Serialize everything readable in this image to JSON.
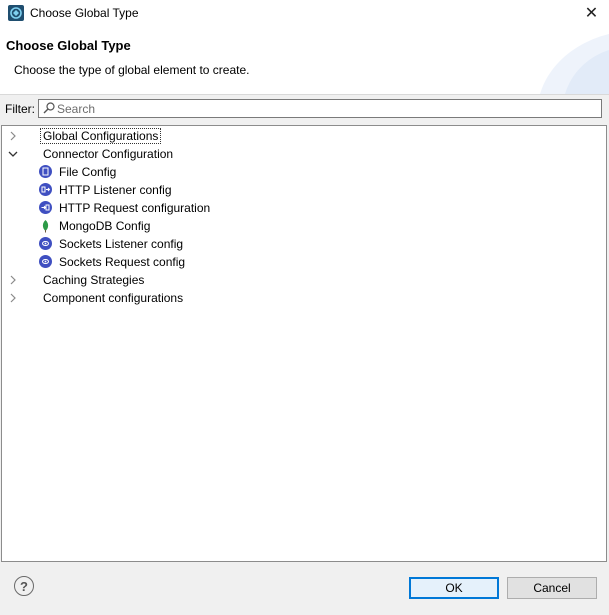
{
  "window": {
    "title": "Choose Global Type",
    "close_glyph": "✕"
  },
  "header": {
    "title": "Choose Global Type",
    "description": "Choose the type of global element to create."
  },
  "filter": {
    "label": "Filter:",
    "placeholder": "Search",
    "value": ""
  },
  "tree": {
    "items": [
      {
        "label": "Global Configurations",
        "expanded": false,
        "focused": true
      },
      {
        "label": "Connector Configuration",
        "expanded": true,
        "children": [
          {
            "label": "File Config",
            "icon": "file-config-icon"
          },
          {
            "label": "HTTP Listener config",
            "icon": "http-listener-icon"
          },
          {
            "label": "HTTP Request configuration",
            "icon": "http-request-icon"
          },
          {
            "label": "MongoDB Config",
            "icon": "mongodb-leaf-icon"
          },
          {
            "label": "Sockets Listener config",
            "icon": "sockets-listener-icon"
          },
          {
            "label": "Sockets Request config",
            "icon": "sockets-request-icon"
          }
        ]
      },
      {
        "label": "Caching Strategies",
        "expanded": false
      },
      {
        "label": "Component configurations",
        "expanded": false
      }
    ]
  },
  "footer": {
    "help_glyph": "?",
    "ok_label": "OK",
    "cancel_label": "Cancel"
  },
  "colors": {
    "accent": "#0078d7",
    "connector_icon": "#3f4fc1",
    "mongodb": "#2e9b48"
  }
}
